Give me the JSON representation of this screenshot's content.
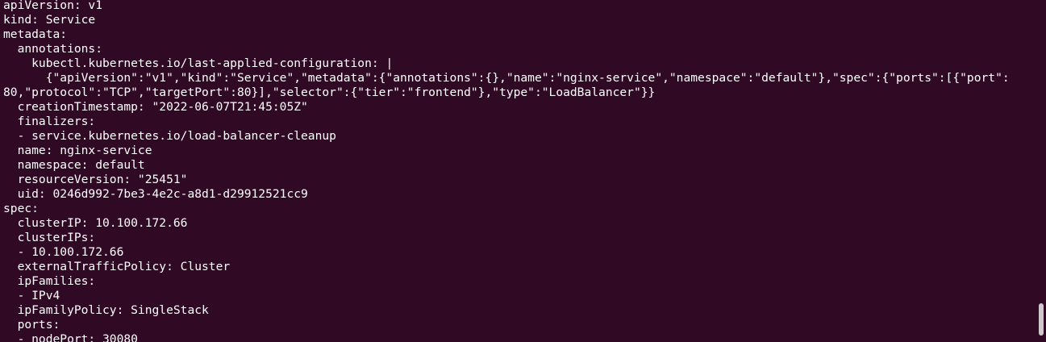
{
  "terminal": {
    "background": "#300a24",
    "foreground": "#ffffff",
    "lines": [
      "apiVersion: v1",
      "kind: Service",
      "metadata:",
      "  annotations:",
      "    kubectl.kubernetes.io/last-applied-configuration: |",
      "      {\"apiVersion\":\"v1\",\"kind\":\"Service\",\"metadata\":{\"annotations\":{},\"name\":\"nginx-service\",\"namespace\":\"default\"},\"spec\":{\"ports\":[{\"port\":",
      "80,\"protocol\":\"TCP\",\"targetPort\":80}],\"selector\":{\"tier\":\"frontend\"},\"type\":\"LoadBalancer\"}}",
      "  creationTimestamp: \"2022-06-07T21:45:05Z\"",
      "  finalizers:",
      "  - service.kubernetes.io/load-balancer-cleanup",
      "  name: nginx-service",
      "  namespace: default",
      "  resourceVersion: \"25451\"",
      "  uid: 0246d992-7be3-4e2c-a8d1-d29912521cc9",
      "spec:",
      "  clusterIP: 10.100.172.66",
      "  clusterIPs:",
      "  - 10.100.172.66",
      "  externalTrafficPolicy: Cluster",
      "  ipFamilies:",
      "  - IPv4",
      "  ipFamilyPolicy: SingleStack",
      "  ports:",
      "  - nodePort: 30080"
    ]
  },
  "scrollbar": {
    "thumb_color": "#cfc8cc",
    "scroll_position": 0.93
  }
}
